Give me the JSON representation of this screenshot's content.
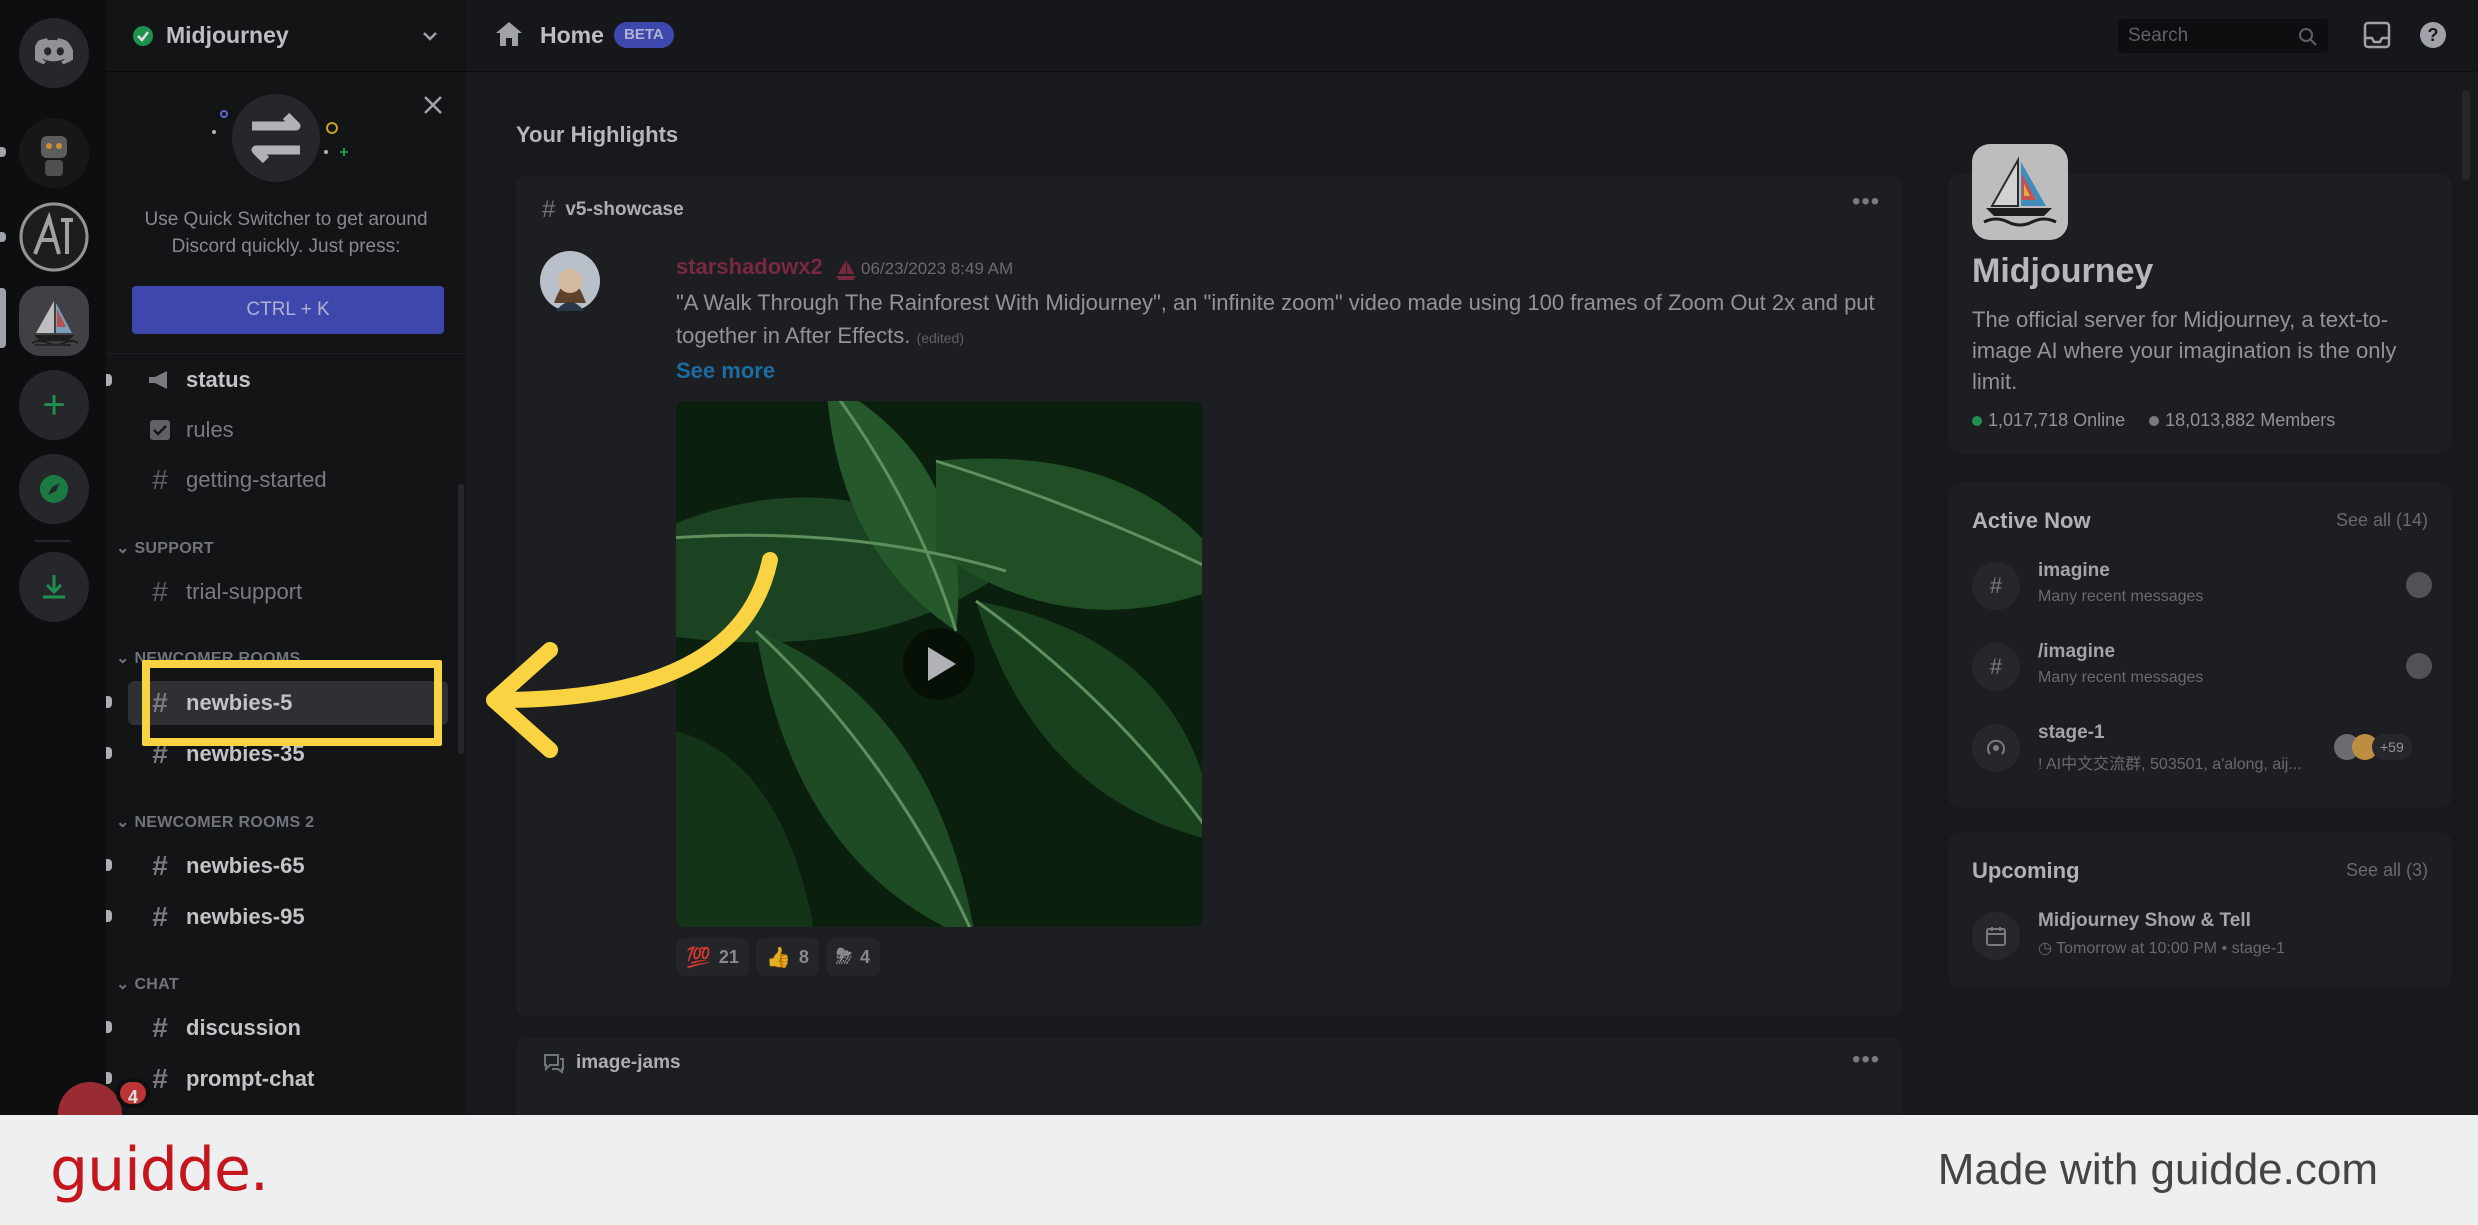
{
  "server": {
    "name": "Midjourney"
  },
  "quick_switcher": {
    "text": "Use Quick Switcher to get around Discord quickly. Just press:",
    "shortcut": "CTRL + K"
  },
  "channels": {
    "top": [
      {
        "label": "status"
      },
      {
        "label": "rules"
      },
      {
        "label": "getting-started"
      }
    ],
    "support_category": "SUPPORT",
    "support": [
      {
        "label": "trial-support"
      }
    ],
    "newcomer_category": "NEWCOMER ROOMS",
    "newcomer": [
      {
        "label": "newbies-5"
      },
      {
        "label": "newbies-35"
      }
    ],
    "newcomer2_category": "NEWCOMER ROOMS 2",
    "newcomer2": [
      {
        "label": "newbies-65"
      },
      {
        "label": "newbies-95"
      }
    ],
    "chat_category": "CHAT",
    "chat": [
      {
        "label": "discussion"
      },
      {
        "label": "prompt-chat"
      }
    ]
  },
  "user": {
    "notification_count": "4"
  },
  "header": {
    "title": "Home",
    "badge": "BETA",
    "search_placeholder": "Search"
  },
  "highlights": {
    "title": "Your Highlights",
    "post": {
      "channel": "v5-showcase",
      "author": "starshadowx2",
      "timestamp": "06/23/2023 8:49 AM",
      "text": "\"A Walk Through The Rainforest With Midjourney\", an \"infinite zoom\" video made using 100 frames of Zoom Out 2x and put together in After Effects.",
      "edited": "(edited)",
      "see_more": "See more",
      "reactions": [
        {
          "emoji": "💯",
          "count": "21"
        },
        {
          "emoji": "👍",
          "count": "8"
        },
        {
          "emoji": "⛈",
          "count": "4"
        }
      ]
    },
    "second_card": {
      "channel": "image-jams"
    }
  },
  "server_info": {
    "name": "Midjourney",
    "description": "The official server for Midjourney, a text-to-image AI where your imagination is the only limit.",
    "online": "1,017,718 Online",
    "members": "18,013,882 Members"
  },
  "active_now": {
    "title": "Active Now",
    "see_all": "See all (14)",
    "items": [
      {
        "name": "imagine",
        "sub": "Many recent messages"
      },
      {
        "name": "/imagine",
        "sub": "Many recent messages"
      },
      {
        "name": "stage-1",
        "sub": "! AI中文交流群, 503501, a'along, aij...",
        "extra": "+59"
      }
    ]
  },
  "upcoming": {
    "title": "Upcoming",
    "see_all": "See all (3)",
    "event_name": "Midjourney Show & Tell",
    "event_time": "Tomorrow at 10:00 PM • ",
    "event_stage": "stage-1"
  },
  "footer": {
    "brand": "guidde.",
    "made_with": "Made with guidde.com"
  },
  "colors": {
    "accent": "#4752c4",
    "highlight": "#f9d342",
    "brand": "#c4161c",
    "online": "#23a55a"
  }
}
